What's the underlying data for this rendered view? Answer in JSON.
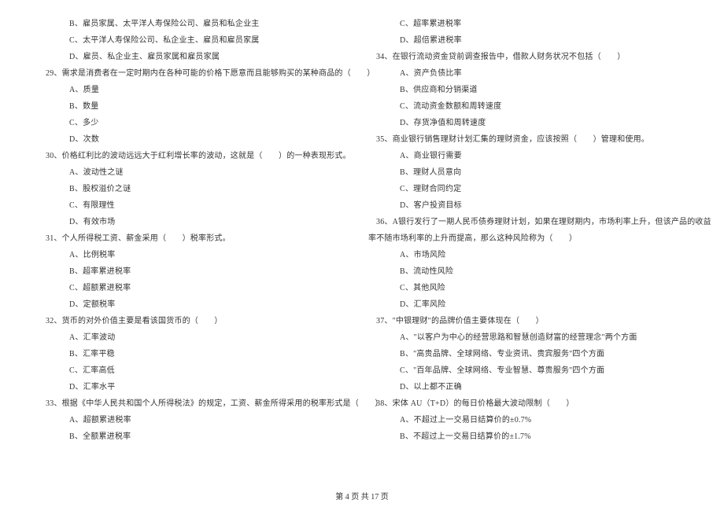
{
  "left": {
    "l1": "B、雇员家属、太平洋人寿保险公司、雇员和私企业主",
    "l2": "C、太平洋人寿保险公司、私企业主、雇员和雇员家属",
    "l3": "D、雇员、私企业主、雇员家属和雇员家属",
    "q29": "29、需求是消费者在一定时期内在各种可能的价格下愿意而且能够购买的某种商品的（　　）",
    "q29a": "A、质量",
    "q29b": "B、数量",
    "q29c": "C、多少",
    "q29d": "D、次数",
    "q30": "30、价格红利比的波动远远大于红利增长率的波动，这就是（　　）的一种表现形式。",
    "q30a": "A、波动性之谜",
    "q30b": "B、股权溢价之谜",
    "q30c": "C、有限理性",
    "q30d": "D、有效市场",
    "q31": "31、个人所得税工资、薪金采用（　　）税率形式。",
    "q31a": "A、比例税率",
    "q31b": "B、超率累进税率",
    "q31c": "C、超额累进税率",
    "q31d": "D、定额税率",
    "q32": "32、货币的对外价值主要是看该国货币的（　　）",
    "q32a": "A、汇率波动",
    "q32b": "B、汇率平稳",
    "q32c": "C、汇率高低",
    "q32d": "D、汇率水平",
    "q33": "33、根据《中华人民共和国个人所得税法》的规定，工资、薪金所得采用的税率形式是（　　）",
    "q33a": "A、超额累进税率",
    "q33b": "B、全额累进税率"
  },
  "right": {
    "r1": "C、超率累进税率",
    "r2": "D、超倍累进税率",
    "q34": "34、在银行流动资金贷前调查报告中，借款人财务状况不包括（　　）",
    "q34a": "A、资产负债比率",
    "q34b": "B、供应商和分销渠道",
    "q34c": "C、流动资金数额和周转速度",
    "q34d": "D、存货净值和周转速度",
    "q35": "35、商业银行销售理财计划汇集的理财资金，应该按照（　　）管理和使用。",
    "q35a": "A、商业银行需要",
    "q35b": "B、理财人员意向",
    "q35c": "C、理财合同约定",
    "q35d": "D、客户投资目标",
    "q36": "36、A银行发行了一期人民币债券理财计划，如果在理财期内，市场利率上升，但该产品的收益",
    "q36cont": "率不随市场利率的上升而提高，那么这种风险称为（　　）",
    "q36a": "A、市场风险",
    "q36b": "B、流动性风险",
    "q36c": "C、其他风险",
    "q36d": "D、汇率风险",
    "q37": "37、\"中银理财\"的品牌价值主要体现在（　　）",
    "q37a": "A、\"以客户为中心的经营思路和智慧创造财富的经营理念\"两个方面",
    "q37b": "B、\"高贵品牌、全球网络、专业资讯、贵宾服务\"四个方面",
    "q37c": "C、\"百年品牌、全球网络、专业智慧、尊贵服务\"四个方面",
    "q37d": "D、以上都不正确",
    "q38": "38、宋体 AU（T+D）的每日价格最大波动限制（　　）",
    "q38a": "A、不超过上一交易日结算价的±0.7%",
    "q38b": "B、不超过上一交易日结算价的±1.7%"
  },
  "footer": "第 4 页 共 17 页"
}
